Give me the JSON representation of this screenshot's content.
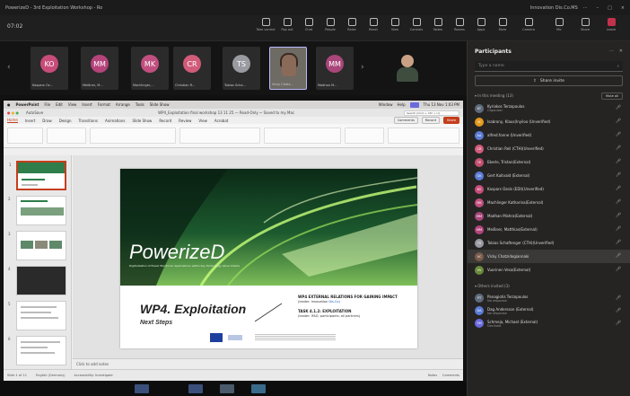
{
  "window": {
    "title": "PowerizeD - 3rd Exploitation Workshop - Ro",
    "account": "Innovation Dis.Co.MS",
    "controls": [
      "···",
      "–",
      "□",
      "×"
    ]
  },
  "meeting": {
    "timer": "07:02",
    "tools": [
      "Take control",
      "Pop out",
      "Chat",
      "People",
      "Raise",
      "React",
      "View",
      "Controls",
      "Notes",
      "Rooms",
      "Apps",
      "More",
      "Camera",
      "Mic",
      "Share",
      "Leave"
    ]
  },
  "gallery": [
    {
      "initials": "KO",
      "name": "Kaspars Oz...",
      "color": "#c74c7a"
    },
    {
      "initials": "MM",
      "name": "Meißner, M...",
      "color": "#b5447b"
    },
    {
      "initials": "MK",
      "name": "Machlinger,...",
      "color": "#c14f7f"
    },
    {
      "initials": "CR",
      "name": "Christian R...",
      "color": "#d15b79"
    },
    {
      "initials": "TS",
      "name": "Tobias Scha...",
      "color": "#9a9aa3"
    },
    {
      "initials": "",
      "name": "Vicky Chatz...",
      "color": "#6e6a64",
      "video": true
    },
    {
      "initials": "MM",
      "name": "Madhan M...",
      "color": "#a9467a"
    }
  ],
  "mac_bar": {
    "items": [
      "PowerPoint",
      "File",
      "Edit",
      "View",
      "Insert",
      "Format",
      "Arrange",
      "Tools",
      "Slide Show",
      "Window",
      "Help"
    ],
    "clock": "Thu 13 Nov 1:03 PM"
  },
  "ppt": {
    "autosave": "AutoSave",
    "file": "WP4_Exploitation final workshop 13 11 25 — Read-Only ~ Saved to my Mac",
    "search": "Search (Cmd + Ctrl + U)",
    "tabs": [
      "Home",
      "Insert",
      "Draw",
      "Design",
      "Transitions",
      "Animations",
      "Slide Show",
      "Record",
      "Review",
      "View",
      "Acrobat"
    ],
    "active_tab": "Home",
    "buttons": [
      "Comments",
      "Record",
      "Share"
    ],
    "notes_placeholder": "Click to add notes",
    "status": {
      "slide": "Slide 1 of 11",
      "lang": "English (Germany)",
      "access": "Accessibility: Investigate",
      "right": [
        "Notes",
        "Comments"
      ]
    }
  },
  "slide": {
    "brand": "PowerizeD",
    "tagline": "Digitalization of Power Electronic Applications within key Technology Value Chains",
    "title": "WP4. Exploitation",
    "subtitle": "Next Steps",
    "r1_title": "WP4 EXTERNAL RELATIONS FOR GAINING IMPACT",
    "r1_leader_label": "(leader: Innovation ",
    "r1_leader_name": "Dis.Co)",
    "r2_title": "TASK 4.1.2: EXPLOITATION",
    "r2_leader": "(leader: IFAG; participants: all partners)"
  },
  "presenter": "Vicky Chatzidogiannaki",
  "panel": {
    "title": "Participants",
    "search_placeholder": "Type a name",
    "share_invite": "Share invite",
    "in_meeting": "In this meeting (13)",
    "mute_all": "Mute all",
    "others": "Others invited (3)",
    "in_meeting_list": [
      {
        "initials": "KT",
        "name": "Kyriakos Terzopoulos",
        "sub": "Organizer",
        "color": "#5e6a7a"
      },
      {
        "initials": "IK",
        "name": "Isabrony, Klaus(Inyiloo (Unverified)",
        "sub": "",
        "color": "#e39a1e"
      },
      {
        "initials": "AA",
        "name": "alfred.fonne (Unverified)",
        "sub": "",
        "color": "#5b7bd5"
      },
      {
        "initials": "CR",
        "name": "Christian Reil (CTH)(Unverified)",
        "sub": "",
        "color": "#d15b79"
      },
      {
        "initials": "TE",
        "name": "Eberle, Tristan(External)",
        "sub": "",
        "color": "#c24f6d"
      },
      {
        "initials": "GK",
        "name": "Gert Kaitvald (External)",
        "sub": "",
        "color": "#5b7bd5"
      },
      {
        "initials": "KO",
        "name": "Kaspars Ozols (EDI)(Unverified)",
        "sub": "",
        "color": "#c74c7a"
      },
      {
        "initials": "MK",
        "name": "Machlinger Katharina(External)",
        "sub": "",
        "color": "#c14f7f"
      },
      {
        "initials": "MM",
        "name": "Madhan Mishra(External)",
        "sub": "",
        "color": "#a9467a"
      },
      {
        "initials": "MM",
        "name": "Meißner, Matthias(External)",
        "sub": "",
        "color": "#b5447b"
      },
      {
        "initials": "TS",
        "name": "Tobias Schaftenger (CTH)(Unverified)",
        "sub": "",
        "color": "#9a9aa3"
      },
      {
        "initials": "VC",
        "name": "Vicky Chatzidogiannaki",
        "sub": "",
        "color": "#7a5a4a",
        "highlight": true
      },
      {
        "initials": "VV",
        "name": "Vuorinen Vesa(External)",
        "sub": "",
        "color": "#6a8a3a"
      }
    ],
    "others_list": [
      {
        "initials": "PT",
        "name": "Panagiotis Terzopoulos",
        "sub": "No response",
        "color": "#5e6a7a"
      },
      {
        "initials": "DA",
        "name": "Dag Andersson (External)",
        "sub": "No response",
        "color": "#5b7bd5"
      },
      {
        "initials": "SM",
        "name": "Schmeja, Michael (External)",
        "sub": "Declined",
        "color": "#6a6adf"
      }
    ]
  }
}
